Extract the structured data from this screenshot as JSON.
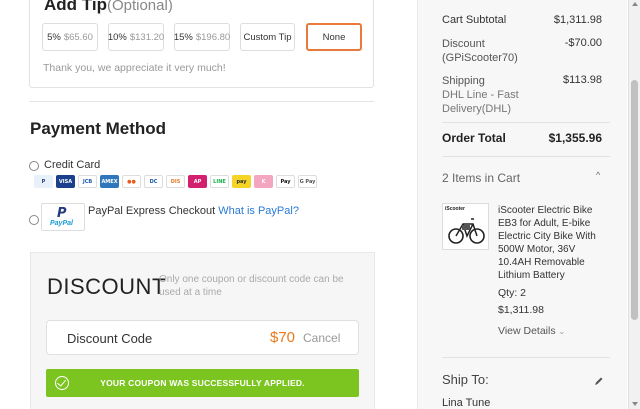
{
  "tip": {
    "title": "Add Tip",
    "optional": "(Optional)",
    "options": [
      {
        "label": "5%",
        "amount": "$65.60"
      },
      {
        "label": "10%",
        "amount": "$131.20"
      },
      {
        "label": "15%",
        "amount": "$196.80"
      },
      {
        "label": "Custom Tip",
        "amount": ""
      },
      {
        "label": "None",
        "amount": ""
      }
    ],
    "selected": "None",
    "thanks": "Thank you, we appreciate it very much!"
  },
  "payment": {
    "title": "Payment Method",
    "credit_card_label": "Credit Card",
    "cards": [
      {
        "icon": "paypal-card-icon",
        "text": "P",
        "bg": "#e8f0fa",
        "fg": "#253b80"
      },
      {
        "icon": "visa-card-icon",
        "text": "VISA",
        "bg": "#1a3f8c",
        "fg": "#ffffff"
      },
      {
        "icon": "jcb-card-icon",
        "text": "JCB",
        "bg": "#ffffff",
        "fg": "#1a5aa8"
      },
      {
        "icon": "amex-card-icon",
        "text": "AMEX",
        "bg": "#2e77bc",
        "fg": "#ffffff"
      },
      {
        "icon": "mastercard-card-icon",
        "text": "●●",
        "bg": "#ffffff",
        "fg": "#eb5a1e"
      },
      {
        "icon": "diners-card-icon",
        "text": "DC",
        "bg": "#ffffff",
        "fg": "#1a5aa8"
      },
      {
        "icon": "discover-card-icon",
        "text": "DIS",
        "bg": "#ffffff",
        "fg": "#e57b2c"
      },
      {
        "icon": "afterpay-card-icon",
        "text": "AP",
        "bg": "#d21f6e",
        "fg": "#ffffff"
      },
      {
        "icon": "line-pay-card-icon",
        "text": "LINE",
        "bg": "#ffffff",
        "fg": "#17b24a"
      },
      {
        "icon": "zip-pay-card-icon",
        "text": "pay",
        "bg": "#f5d327",
        "fg": "#333333"
      },
      {
        "icon": "klarna-card-icon",
        "text": "K",
        "bg": "#f4a6c0",
        "fg": "#ffffff"
      },
      {
        "icon": "apple-pay-card-icon",
        "text": "Pay",
        "bg": "#ffffff",
        "fg": "#111111"
      },
      {
        "icon": "google-pay-card-icon",
        "text": "G Pay",
        "bg": "#ffffff",
        "fg": "#555555"
      }
    ],
    "paypal_label": "PayPal Express Checkout",
    "paypal_link": "What is PayPal?",
    "paypal_logo_text": "PayPal"
  },
  "discount": {
    "title": "DISCOUNT",
    "note": "Only one coupon or discount code can be used at a time",
    "code_label": "Discount Code",
    "amount": "$70",
    "cancel": "Cancel",
    "success": "YOUR COUPON WAS SUCCESSFULLY APPLIED."
  },
  "summary": {
    "subtotal_label": "Cart Subtotal",
    "subtotal_value": "$1,311.98",
    "discount_label": "Discount",
    "discount_code": "(GPiScooter70)",
    "discount_value": "-$70.00",
    "shipping_label": "Shipping",
    "shipping_method": "DHL Line - Fast Delivery(DHL)",
    "shipping_value": "$113.98",
    "total_label": "Order Total",
    "total_value": "$1,355.96"
  },
  "cart": {
    "header": "2 Items in Cart",
    "item": {
      "thumb_brand": "iScooter",
      "name": "iScooter Electric Bike EB3 for Adult, E-bike Electric City Bike With 500W Motor, 36V 10.4AH Removable Lithium Battery",
      "qty": "Qty: 2",
      "price": "$1,311.98",
      "view_details": "View Details"
    }
  },
  "ship_to": {
    "label": "Ship To:",
    "name": "Lina Tune"
  },
  "colors": {
    "accent": "#e97a3b",
    "success": "#7cc520",
    "link": "#2a7ad5"
  }
}
